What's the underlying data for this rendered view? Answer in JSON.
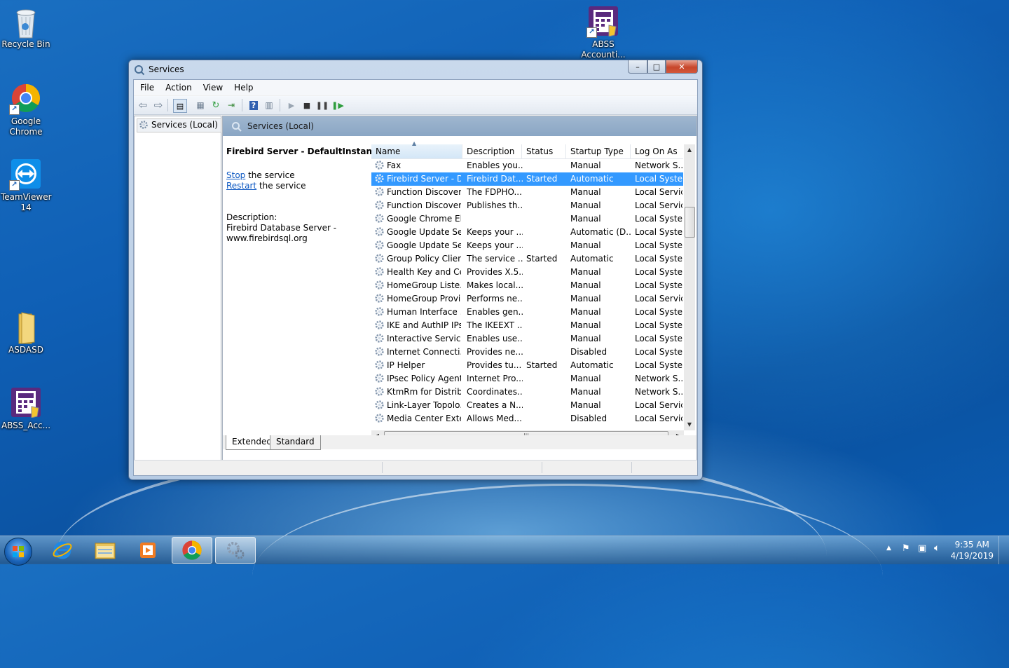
{
  "desktop": {
    "icons": [
      {
        "label": "Recycle Bin"
      },
      {
        "label": "Google Chrome"
      },
      {
        "label": "TeamViewer 14"
      },
      {
        "label": "ASDASD"
      },
      {
        "label": "ABSS_Acc..."
      },
      {
        "label": "ABSS Accounti..."
      }
    ]
  },
  "window": {
    "title": "Services",
    "caption": {
      "minimize": "–",
      "maximize": "□",
      "close": "✕"
    }
  },
  "menu": [
    "File",
    "Action",
    "View",
    "Help"
  ],
  "tree": {
    "item": "Services (Local)"
  },
  "content_header": "Services (Local)",
  "extended": {
    "service_name": "Firebird Server - DefaultInstance",
    "stop_link": "Stop",
    "stop_rest": " the service",
    "restart_link": "Restart",
    "restart_rest": " the service",
    "description_label": "Description:",
    "description_line1": "Firebird Database Server -",
    "description_line2": "www.firebirdsql.org"
  },
  "columns": [
    "Name",
    "Description",
    "Status",
    "Startup Type",
    "Log On As"
  ],
  "rows": [
    {
      "name": "Fax",
      "description": "Enables you...",
      "status": "",
      "startup": "Manual",
      "logon": "Network S..."
    },
    {
      "name": "Firebird Server - D...",
      "description": "Firebird Dat...",
      "status": "Started",
      "startup": "Automatic",
      "logon": "Local Syste...",
      "selected": true
    },
    {
      "name": "Function Discover...",
      "description": "The FDPHO...",
      "status": "",
      "startup": "Manual",
      "logon": "Local Service"
    },
    {
      "name": "Function Discover...",
      "description": "Publishes th...",
      "status": "",
      "startup": "Manual",
      "logon": "Local Service"
    },
    {
      "name": "Google Chrome El...",
      "description": "",
      "status": "",
      "startup": "Manual",
      "logon": "Local Syste..."
    },
    {
      "name": "Google Update Se...",
      "description": "Keeps your ...",
      "status": "",
      "startup": "Automatic (D...",
      "logon": "Local Syste..."
    },
    {
      "name": "Google Update Se...",
      "description": "Keeps your ...",
      "status": "",
      "startup": "Manual",
      "logon": "Local Syste..."
    },
    {
      "name": "Group Policy Client",
      "description": "The service ...",
      "status": "Started",
      "startup": "Automatic",
      "logon": "Local Syste..."
    },
    {
      "name": "Health Key and Ce...",
      "description": "Provides X.5...",
      "status": "",
      "startup": "Manual",
      "logon": "Local Syste..."
    },
    {
      "name": "HomeGroup Liste...",
      "description": "Makes local...",
      "status": "",
      "startup": "Manual",
      "logon": "Local Syste..."
    },
    {
      "name": "HomeGroup Provi...",
      "description": "Performs ne...",
      "status": "",
      "startup": "Manual",
      "logon": "Local Service"
    },
    {
      "name": "Human Interface ...",
      "description": "Enables gen...",
      "status": "",
      "startup": "Manual",
      "logon": "Local Syste..."
    },
    {
      "name": "IKE and AuthIP IPs...",
      "description": "The IKEEXT ...",
      "status": "",
      "startup": "Manual",
      "logon": "Local Syste..."
    },
    {
      "name": "Interactive Service...",
      "description": "Enables use...",
      "status": "",
      "startup": "Manual",
      "logon": "Local Syste..."
    },
    {
      "name": "Internet Connecti...",
      "description": "Provides ne...",
      "status": "",
      "startup": "Disabled",
      "logon": "Local Syste..."
    },
    {
      "name": "IP Helper",
      "description": "Provides tu...",
      "status": "Started",
      "startup": "Automatic",
      "logon": "Local Syste..."
    },
    {
      "name": "IPsec Policy Agent",
      "description": "Internet Pro...",
      "status": "",
      "startup": "Manual",
      "logon": "Network S..."
    },
    {
      "name": "KtmRm for Distrib...",
      "description": "Coordinates...",
      "status": "",
      "startup": "Manual",
      "logon": "Network S..."
    },
    {
      "name": "Link-Layer Topolo...",
      "description": "Creates a N...",
      "status": "",
      "startup": "Manual",
      "logon": "Local Service"
    },
    {
      "name": "Media Center Exte...",
      "description": "Allows Med...",
      "status": "",
      "startup": "Disabled",
      "logon": "Local Service"
    }
  ],
  "tabs": [
    "Extended",
    "Standard"
  ],
  "taskbar": {
    "time": "9:35 AM",
    "date": "4/19/2019"
  }
}
